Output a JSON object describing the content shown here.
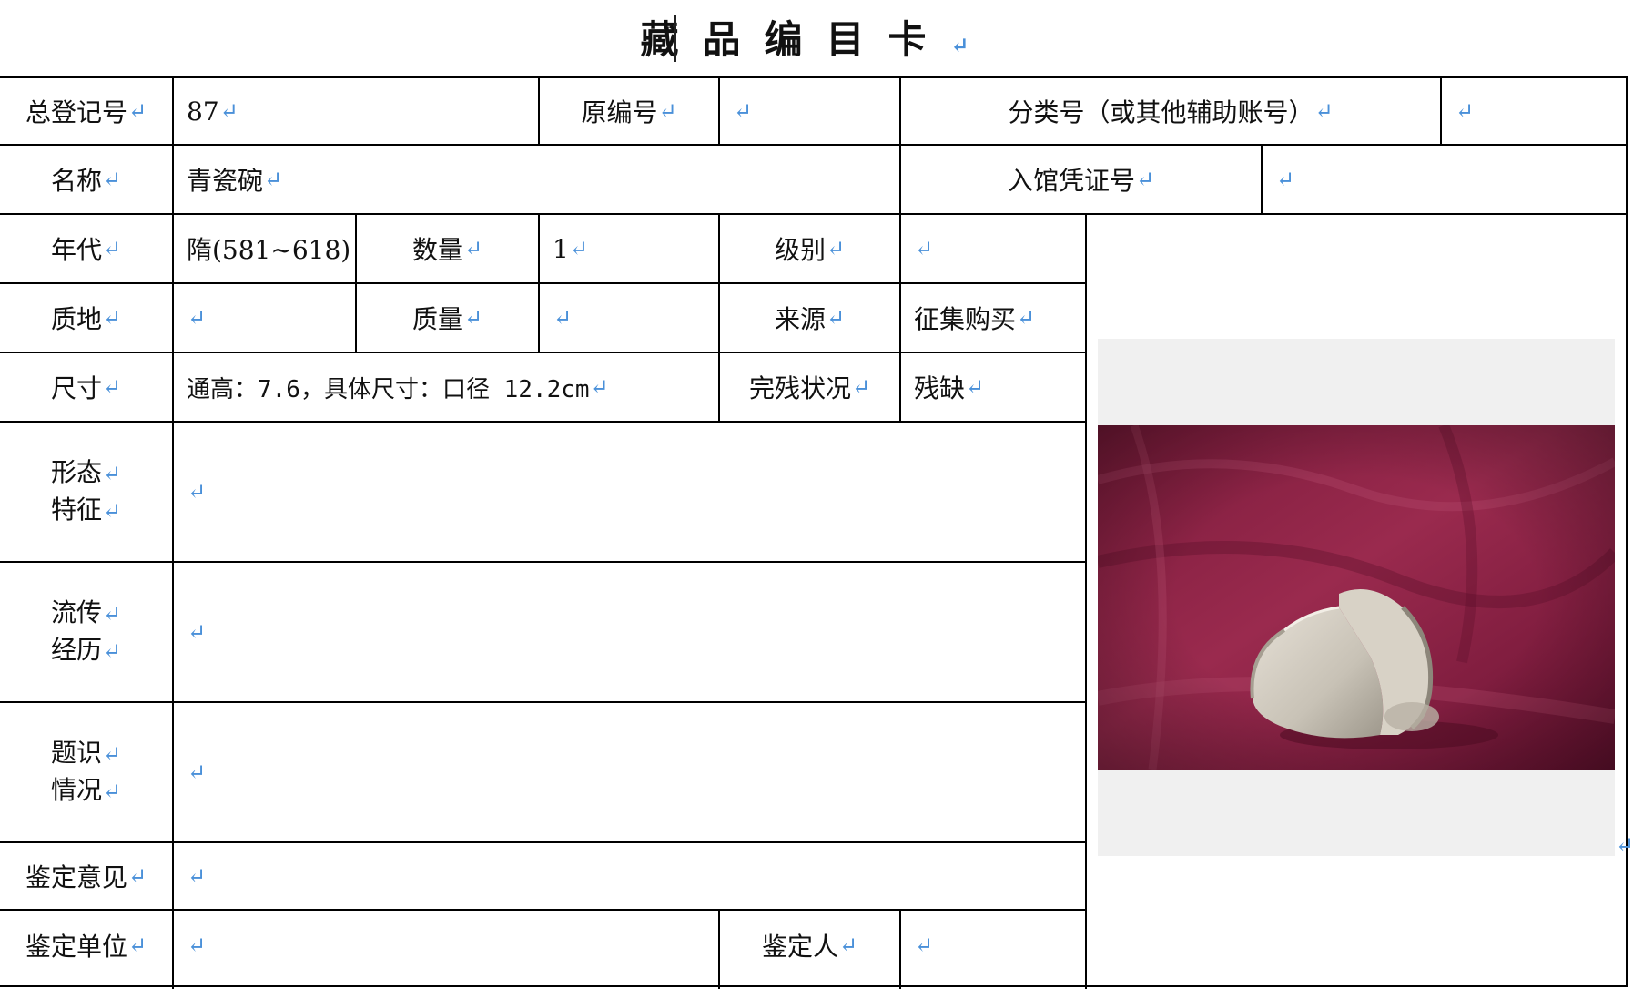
{
  "title": "藏品编目卡",
  "return_mark": "↵",
  "fields": {
    "total_reg_no": {
      "label": "总登记号",
      "value": "87"
    },
    "original_no": {
      "label": "原编号",
      "value": ""
    },
    "class_no": {
      "label": "分类号（或其他辅助账号）",
      "value": ""
    },
    "name": {
      "label": "名称",
      "value": "青瓷碗"
    },
    "entry_voucher_no": {
      "label": "入馆凭证号",
      "value": ""
    },
    "era": {
      "label": "年代",
      "value": "隋(581~618)"
    },
    "quantity": {
      "label": "数量",
      "value": "1"
    },
    "grade": {
      "label": "级别",
      "value": ""
    },
    "material": {
      "label": "质地",
      "value": ""
    },
    "weight": {
      "label": "质量",
      "value": ""
    },
    "source": {
      "label": "来源",
      "value": "征集购买"
    },
    "dimensions": {
      "label": "尺寸",
      "value": "通高：7.6，具体尺寸：口径 12.2cm"
    },
    "condition": {
      "label": "完残状况",
      "value": "残缺"
    },
    "form_features": {
      "label_line1": "形态",
      "label_line2": "特征",
      "value": ""
    },
    "provenance": {
      "label_line1": "流传",
      "label_line2": "经历",
      "value": ""
    },
    "inscriptions": {
      "label_line1": "题识",
      "label_line2": "情况",
      "value": ""
    },
    "appraisal_opinion": {
      "label": "鉴定意见",
      "value": ""
    },
    "appraisal_unit": {
      "label": "鉴定单位",
      "value": ""
    },
    "appraiser": {
      "label": "鉴定人",
      "value": ""
    }
  },
  "colors": {
    "return_mark": "#4a90d9",
    "photo_cloth": "#8e2244",
    "photo_bg": "#f0f0f0"
  }
}
